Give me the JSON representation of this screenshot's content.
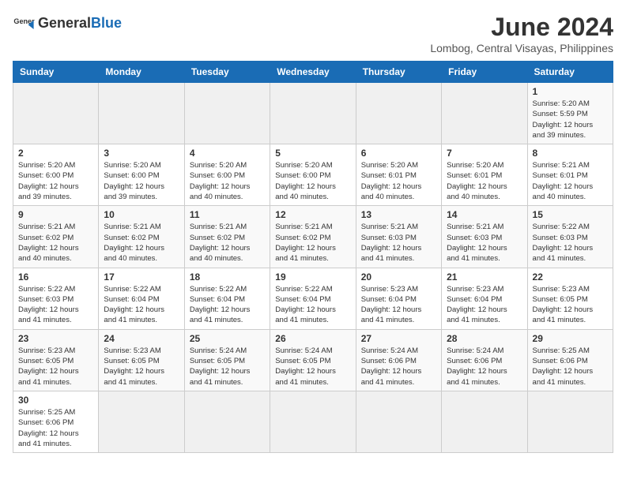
{
  "header": {
    "logo_general": "General",
    "logo_blue": "Blue",
    "title": "June 2024",
    "subtitle": "Lombog, Central Visayas, Philippines"
  },
  "weekdays": [
    "Sunday",
    "Monday",
    "Tuesday",
    "Wednesday",
    "Thursday",
    "Friday",
    "Saturday"
  ],
  "weeks": [
    [
      {
        "day": "",
        "info": ""
      },
      {
        "day": "",
        "info": ""
      },
      {
        "day": "",
        "info": ""
      },
      {
        "day": "",
        "info": ""
      },
      {
        "day": "",
        "info": ""
      },
      {
        "day": "",
        "info": ""
      },
      {
        "day": "1",
        "info": "Sunrise: 5:20 AM\nSunset: 5:59 PM\nDaylight: 12 hours\nand 39 minutes."
      }
    ],
    [
      {
        "day": "2",
        "info": "Sunrise: 5:20 AM\nSunset: 6:00 PM\nDaylight: 12 hours\nand 39 minutes."
      },
      {
        "day": "3",
        "info": "Sunrise: 5:20 AM\nSunset: 6:00 PM\nDaylight: 12 hours\nand 39 minutes."
      },
      {
        "day": "4",
        "info": "Sunrise: 5:20 AM\nSunset: 6:00 PM\nDaylight: 12 hours\nand 40 minutes."
      },
      {
        "day": "5",
        "info": "Sunrise: 5:20 AM\nSunset: 6:00 PM\nDaylight: 12 hours\nand 40 minutes."
      },
      {
        "day": "6",
        "info": "Sunrise: 5:20 AM\nSunset: 6:01 PM\nDaylight: 12 hours\nand 40 minutes."
      },
      {
        "day": "7",
        "info": "Sunrise: 5:20 AM\nSunset: 6:01 PM\nDaylight: 12 hours\nand 40 minutes."
      },
      {
        "day": "8",
        "info": "Sunrise: 5:21 AM\nSunset: 6:01 PM\nDaylight: 12 hours\nand 40 minutes."
      }
    ],
    [
      {
        "day": "9",
        "info": "Sunrise: 5:21 AM\nSunset: 6:02 PM\nDaylight: 12 hours\nand 40 minutes."
      },
      {
        "day": "10",
        "info": "Sunrise: 5:21 AM\nSunset: 6:02 PM\nDaylight: 12 hours\nand 40 minutes."
      },
      {
        "day": "11",
        "info": "Sunrise: 5:21 AM\nSunset: 6:02 PM\nDaylight: 12 hours\nand 40 minutes."
      },
      {
        "day": "12",
        "info": "Sunrise: 5:21 AM\nSunset: 6:02 PM\nDaylight: 12 hours\nand 41 minutes."
      },
      {
        "day": "13",
        "info": "Sunrise: 5:21 AM\nSunset: 6:03 PM\nDaylight: 12 hours\nand 41 minutes."
      },
      {
        "day": "14",
        "info": "Sunrise: 5:21 AM\nSunset: 6:03 PM\nDaylight: 12 hours\nand 41 minutes."
      },
      {
        "day": "15",
        "info": "Sunrise: 5:22 AM\nSunset: 6:03 PM\nDaylight: 12 hours\nand 41 minutes."
      }
    ],
    [
      {
        "day": "16",
        "info": "Sunrise: 5:22 AM\nSunset: 6:03 PM\nDaylight: 12 hours\nand 41 minutes."
      },
      {
        "day": "17",
        "info": "Sunrise: 5:22 AM\nSunset: 6:04 PM\nDaylight: 12 hours\nand 41 minutes."
      },
      {
        "day": "18",
        "info": "Sunrise: 5:22 AM\nSunset: 6:04 PM\nDaylight: 12 hours\nand 41 minutes."
      },
      {
        "day": "19",
        "info": "Sunrise: 5:22 AM\nSunset: 6:04 PM\nDaylight: 12 hours\nand 41 minutes."
      },
      {
        "day": "20",
        "info": "Sunrise: 5:23 AM\nSunset: 6:04 PM\nDaylight: 12 hours\nand 41 minutes."
      },
      {
        "day": "21",
        "info": "Sunrise: 5:23 AM\nSunset: 6:04 PM\nDaylight: 12 hours\nand 41 minutes."
      },
      {
        "day": "22",
        "info": "Sunrise: 5:23 AM\nSunset: 6:05 PM\nDaylight: 12 hours\nand 41 minutes."
      }
    ],
    [
      {
        "day": "23",
        "info": "Sunrise: 5:23 AM\nSunset: 6:05 PM\nDaylight: 12 hours\nand 41 minutes."
      },
      {
        "day": "24",
        "info": "Sunrise: 5:23 AM\nSunset: 6:05 PM\nDaylight: 12 hours\nand 41 minutes."
      },
      {
        "day": "25",
        "info": "Sunrise: 5:24 AM\nSunset: 6:05 PM\nDaylight: 12 hours\nand 41 minutes."
      },
      {
        "day": "26",
        "info": "Sunrise: 5:24 AM\nSunset: 6:05 PM\nDaylight: 12 hours\nand 41 minutes."
      },
      {
        "day": "27",
        "info": "Sunrise: 5:24 AM\nSunset: 6:06 PM\nDaylight: 12 hours\nand 41 minutes."
      },
      {
        "day": "28",
        "info": "Sunrise: 5:24 AM\nSunset: 6:06 PM\nDaylight: 12 hours\nand 41 minutes."
      },
      {
        "day": "29",
        "info": "Sunrise: 5:25 AM\nSunset: 6:06 PM\nDaylight: 12 hours\nand 41 minutes."
      }
    ],
    [
      {
        "day": "30",
        "info": "Sunrise: 5:25 AM\nSunset: 6:06 PM\nDaylight: 12 hours\nand 41 minutes."
      },
      {
        "day": "",
        "info": ""
      },
      {
        "day": "",
        "info": ""
      },
      {
        "day": "",
        "info": ""
      },
      {
        "day": "",
        "info": ""
      },
      {
        "day": "",
        "info": ""
      },
      {
        "day": "",
        "info": ""
      }
    ]
  ]
}
